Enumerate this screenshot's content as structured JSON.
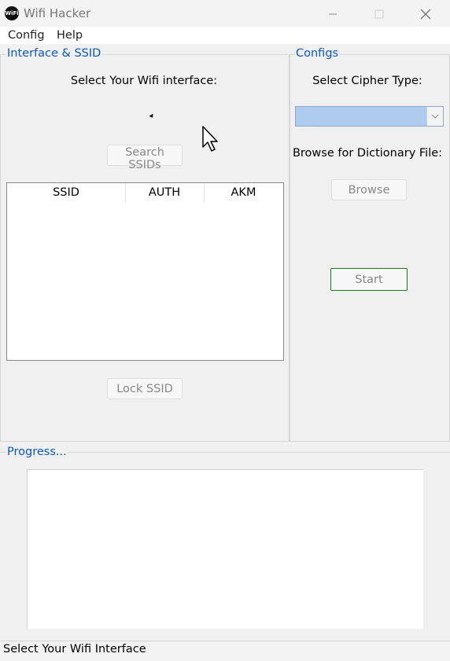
{
  "window": {
    "title": "Wifi Hacker",
    "icon_text": "WiFi",
    "minimize_icon": "minimize-icon",
    "maximize_icon": "maximize-icon",
    "close_icon": "close-icon"
  },
  "menu": {
    "items": [
      "Config",
      "Help"
    ]
  },
  "interface_group": {
    "title": "Interface & SSID",
    "select_label": "Select Your Wifi interface:",
    "search_button": "Search SSIDs",
    "table": {
      "columns": [
        "SSID",
        "AUTH",
        "AKM"
      ],
      "rows": []
    },
    "lock_button": "Lock SSID"
  },
  "configs_group": {
    "title": "Configs",
    "cipher_label": "Select Cipher Type:",
    "cipher_value": "",
    "dictionary_label": "Browse for Dictionary File:",
    "browse_button": "Browse",
    "start_button": "Start"
  },
  "progress_group": {
    "title": "Progress...",
    "log": ""
  },
  "status_bar": {
    "text": "Select Your Wifi Interface"
  },
  "colors": {
    "group_title": "#0a58c2",
    "combo_selected": "#afcbee",
    "start_border": "#1a7a1a"
  }
}
